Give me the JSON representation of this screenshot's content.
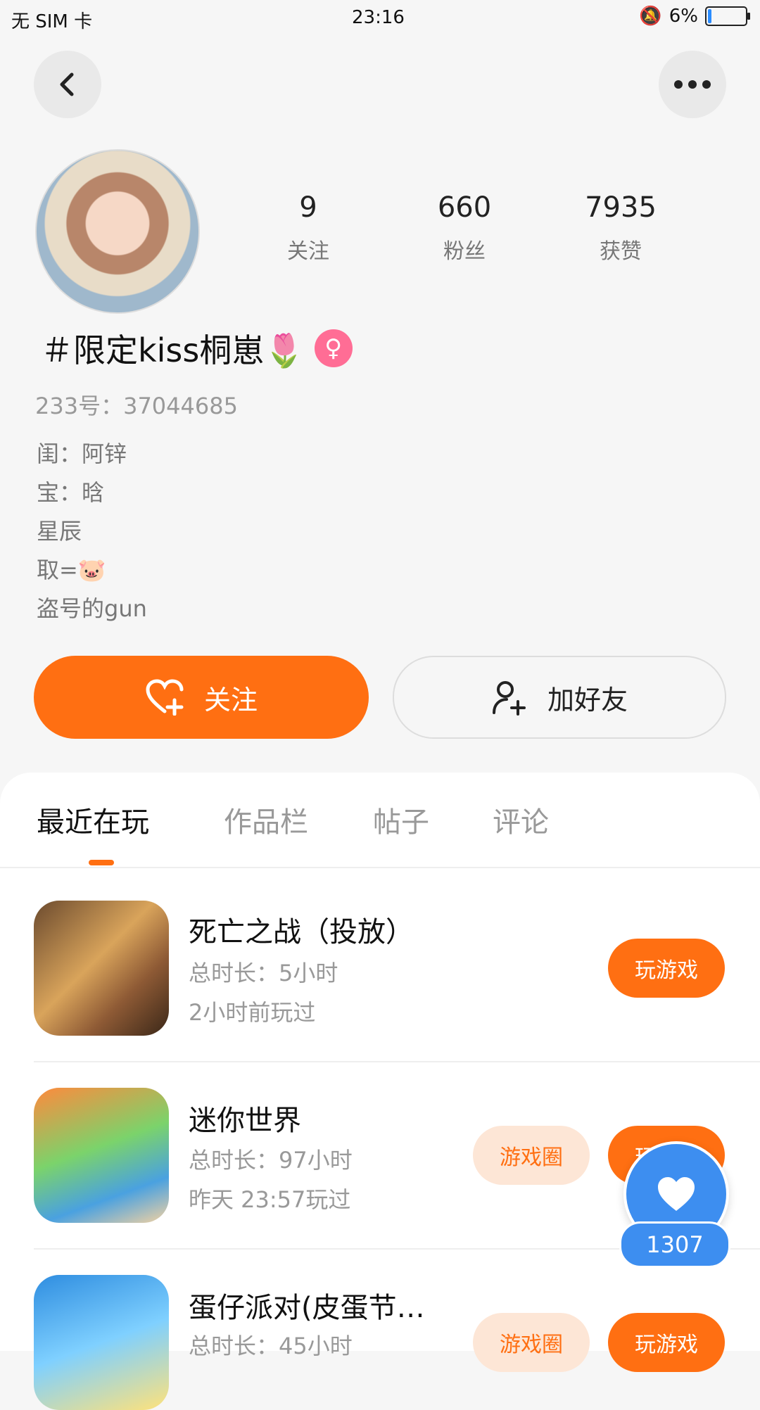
{
  "status_bar": {
    "carrier": "无 SIM 卡",
    "time": "23:16",
    "battery": "6%"
  },
  "profile": {
    "stats": [
      {
        "value": "9",
        "label": "关注"
      },
      {
        "value": "660",
        "label": "粉丝"
      },
      {
        "value": "7935",
        "label": "获赞"
      }
    ],
    "name": "＃限定kiss桐崽🌷",
    "gender_symbol": "♀",
    "uid": "233号：37044685",
    "bio": [
      "闺：阿锌",
      "宝：晗",
      "星辰",
      "取=🐷",
      "盗号的gun"
    ]
  },
  "actions": {
    "follow": "关注",
    "add_friend": "加好友"
  },
  "tabs": [
    "最近在玩",
    "作品栏",
    "帖子",
    "评论"
  ],
  "games": [
    {
      "title": "死亡之战（投放）",
      "duration": "总时长：5小时",
      "last_played": "2小时前玩过",
      "play_label": "玩游戏",
      "circle_label": ""
    },
    {
      "title": "迷你世界",
      "duration": "总时长：97小时",
      "last_played": "昨天 23:57玩过",
      "play_label": "玩游戏",
      "circle_label": "游戏圈"
    },
    {
      "title": "蛋仔派对(皮蛋节…",
      "duration": "总时长：45小时",
      "last_played": "",
      "play_label": "玩游戏",
      "circle_label": "游戏圈"
    }
  ],
  "like_fab": {
    "count": "1307"
  },
  "colors": {
    "accent": "#ff6f12",
    "like_blue": "#3d8ef0",
    "gender_pink": "#ff6d95"
  }
}
